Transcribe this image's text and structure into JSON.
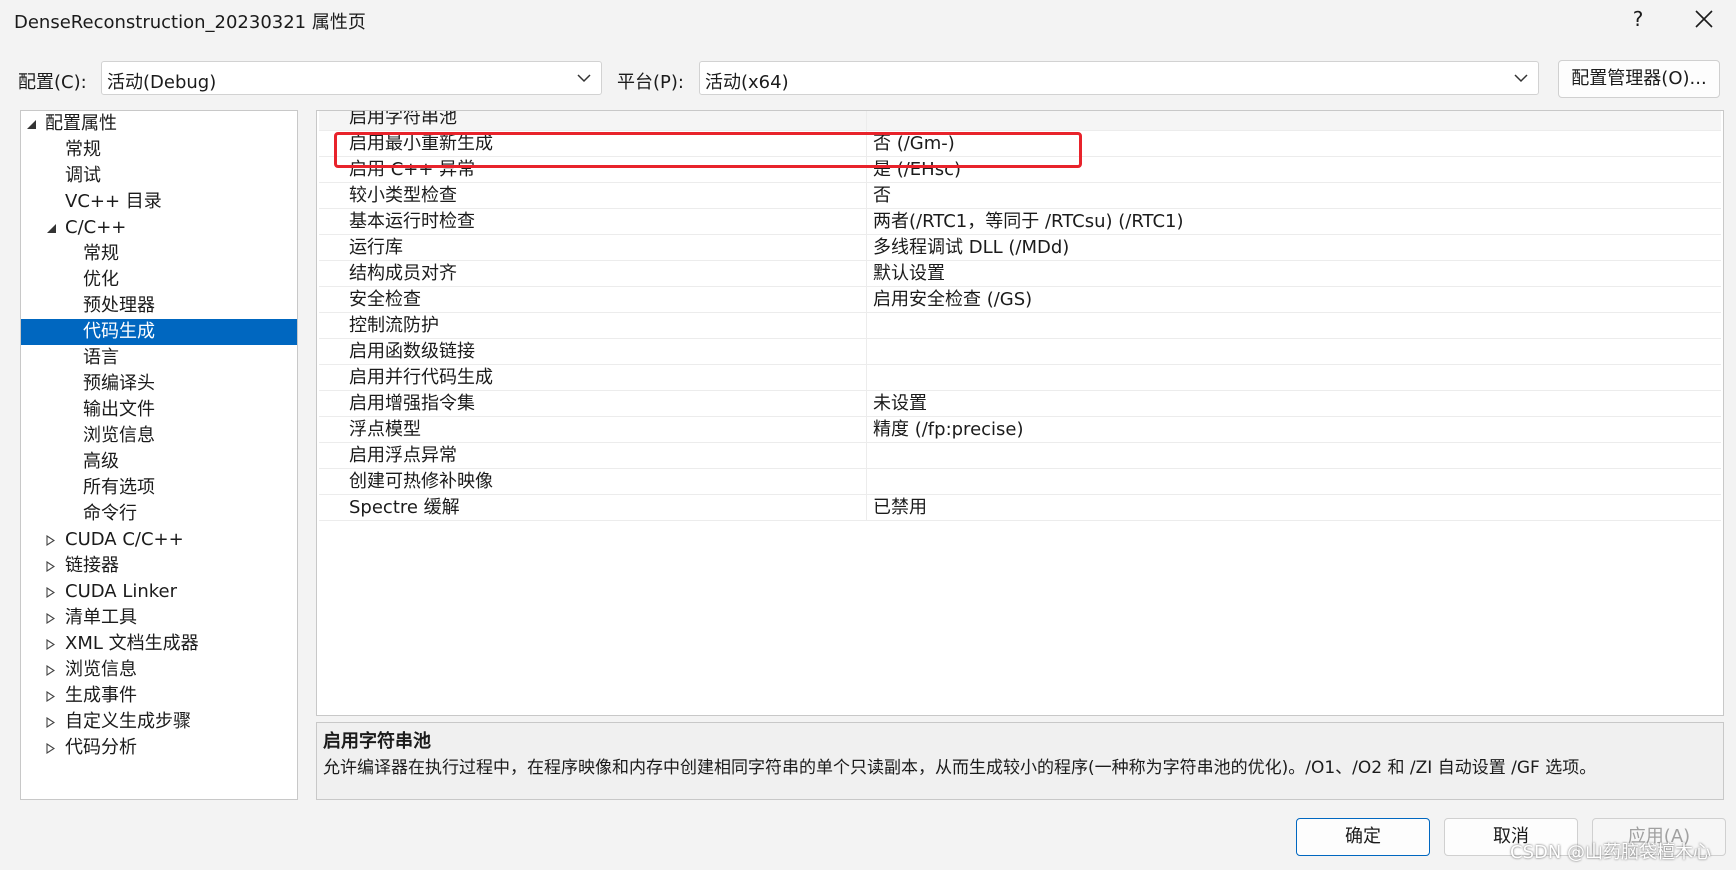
{
  "window": {
    "title": "DenseReconstruction_20230321 属性页",
    "help_label": "?"
  },
  "config_bar": {
    "config_label": "配置(C):",
    "config_value": "活动(Debug)",
    "platform_label": "平台(P):",
    "platform_value": "活动(x64)",
    "manager_button": "配置管理器(O)..."
  },
  "tree": {
    "items": [
      {
        "label": "配置属性",
        "level": 0,
        "expander": "expanded"
      },
      {
        "label": "常规",
        "level": 1,
        "expander": "none"
      },
      {
        "label": "调试",
        "level": 1,
        "expander": "none"
      },
      {
        "label": "VC++ 目录",
        "level": 1,
        "expander": "none"
      },
      {
        "label": "C/C++",
        "level": 1,
        "expander": "expanded"
      },
      {
        "label": "常规",
        "level": 2,
        "expander": "none"
      },
      {
        "label": "优化",
        "level": 2,
        "expander": "none"
      },
      {
        "label": "预处理器",
        "level": 2,
        "expander": "none"
      },
      {
        "label": "代码生成",
        "level": 2,
        "expander": "none",
        "selected": true
      },
      {
        "label": "语言",
        "level": 2,
        "expander": "none"
      },
      {
        "label": "预编译头",
        "level": 2,
        "expander": "none"
      },
      {
        "label": "输出文件",
        "level": 2,
        "expander": "none"
      },
      {
        "label": "浏览信息",
        "level": 2,
        "expander": "none"
      },
      {
        "label": "高级",
        "level": 2,
        "expander": "none"
      },
      {
        "label": "所有选项",
        "level": 2,
        "expander": "none"
      },
      {
        "label": "命令行",
        "level": 2,
        "expander": "none"
      },
      {
        "label": "CUDA C/C++",
        "level": 1,
        "expander": "collapsed"
      },
      {
        "label": "链接器",
        "level": 1,
        "expander": "collapsed"
      },
      {
        "label": "CUDA Linker",
        "level": 1,
        "expander": "collapsed"
      },
      {
        "label": "清单工具",
        "level": 1,
        "expander": "collapsed"
      },
      {
        "label": "XML 文档生成器",
        "level": 1,
        "expander": "collapsed"
      },
      {
        "label": "浏览信息",
        "level": 1,
        "expander": "collapsed"
      },
      {
        "label": "生成事件",
        "level": 1,
        "expander": "collapsed"
      },
      {
        "label": "自定义生成步骤",
        "level": 1,
        "expander": "collapsed"
      },
      {
        "label": "代码分析",
        "level": 1,
        "expander": "collapsed"
      }
    ]
  },
  "properties": [
    {
      "name": "启用字符串池",
      "value": ""
    },
    {
      "name": "启用最小重新生成",
      "value": "否 (/Gm-)"
    },
    {
      "name": "启用 C++ 异常",
      "value": "是 (/EHsc)"
    },
    {
      "name": "较小类型检查",
      "value": "否"
    },
    {
      "name": "基本运行时检查",
      "value": "两者(/RTC1，等同于 /RTCsu) (/RTC1)"
    },
    {
      "name": "运行库",
      "value": "多线程调试 DLL (/MDd)"
    },
    {
      "name": "结构成员对齐",
      "value": "默认设置"
    },
    {
      "name": "安全检查",
      "value": "启用安全检查 (/GS)"
    },
    {
      "name": "控制流防护",
      "value": ""
    },
    {
      "name": "启用函数级链接",
      "value": ""
    },
    {
      "name": "启用并行代码生成",
      "value": ""
    },
    {
      "name": "启用增强指令集",
      "value": "未设置"
    },
    {
      "name": "浮点模型",
      "value": "精度 (/fp:precise)"
    },
    {
      "name": "启用浮点异常",
      "value": ""
    },
    {
      "name": "创建可热修补映像",
      "value": ""
    },
    {
      "name": "Spectre 缓解",
      "value": "已禁用"
    }
  ],
  "description": {
    "title": "启用字符串池",
    "text": "允许编译器在执行过程中，在程序映像和内存中创建相同字符串的单个只读副本，从而生成较小的程序(一种称为字符串池的优化)。/O1、/O2 和 /ZI 自动设置 /GF 选项。"
  },
  "buttons": {
    "ok": "确定",
    "cancel": "取消",
    "apply": "应用(A)"
  },
  "watermark": "CSDN @山药脑袋檀木心",
  "colors": {
    "selection": "#0067c0",
    "highlight_box": "#e8232b"
  }
}
